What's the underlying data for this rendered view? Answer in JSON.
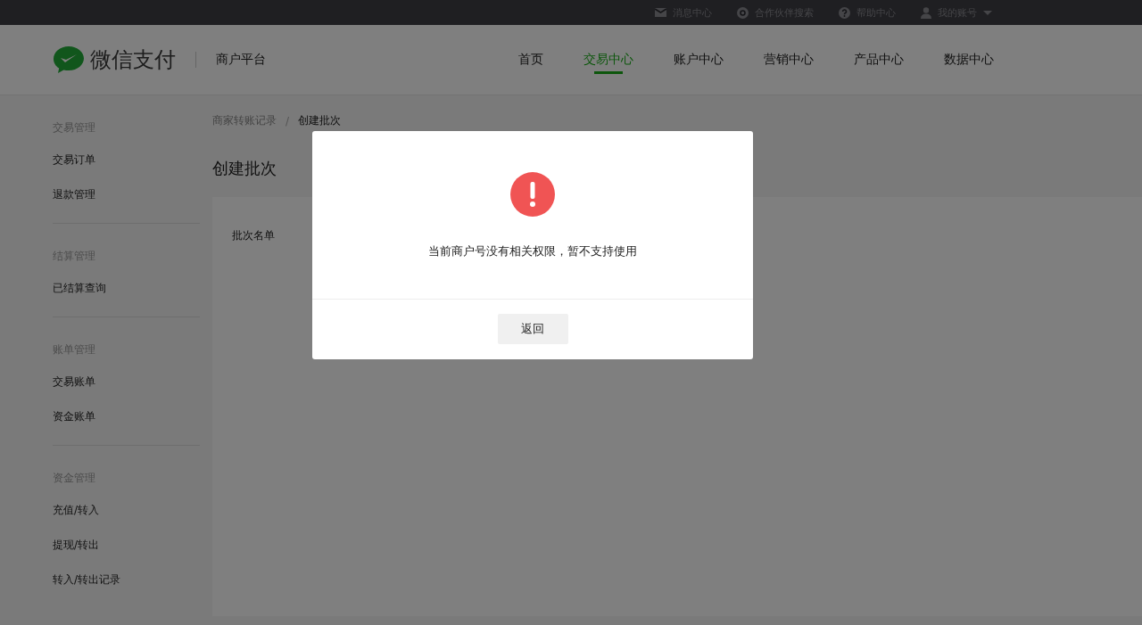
{
  "top_links": [
    {
      "kind": "mail",
      "label": "消息中心"
    },
    {
      "kind": "search",
      "label": "合作伙伴搜索"
    },
    {
      "kind": "help",
      "label": "帮助中心"
    },
    {
      "kind": "user",
      "label": "我的账号",
      "dropdown": true
    }
  ],
  "brand": {
    "name": "微信支付",
    "subtitle": "商户平台"
  },
  "nav_tabs": [
    {
      "label": "首页",
      "selected": false
    },
    {
      "label": "交易中心",
      "selected": true
    },
    {
      "label": "账户中心",
      "selected": false
    },
    {
      "label": "营销中心",
      "selected": false
    },
    {
      "label": "产品中心",
      "selected": false
    },
    {
      "label": "数据中心",
      "selected": false
    }
  ],
  "sidebar": {
    "groups": [
      {
        "title": "交易管理",
        "items": [
          "交易订单",
          "退款管理"
        ]
      },
      {
        "title": "结算管理",
        "items": [
          "已结算查询"
        ]
      },
      {
        "title": "账单管理",
        "items": [
          "交易账单",
          "资金账单"
        ]
      },
      {
        "title": "资金管理",
        "items": [
          "充值/转入",
          "提现/转出",
          "转入/转出记录"
        ]
      }
    ]
  },
  "breadcrumb": {
    "separator": "/",
    "items": [
      "商家转账记录",
      "创建批次"
    ]
  },
  "page_title": "创建批次",
  "form": {
    "field_label": "批次名单"
  },
  "dialog": {
    "kind": "error",
    "message": "当前商户号没有相关权限，暂不支持使用",
    "button": "返回"
  }
}
